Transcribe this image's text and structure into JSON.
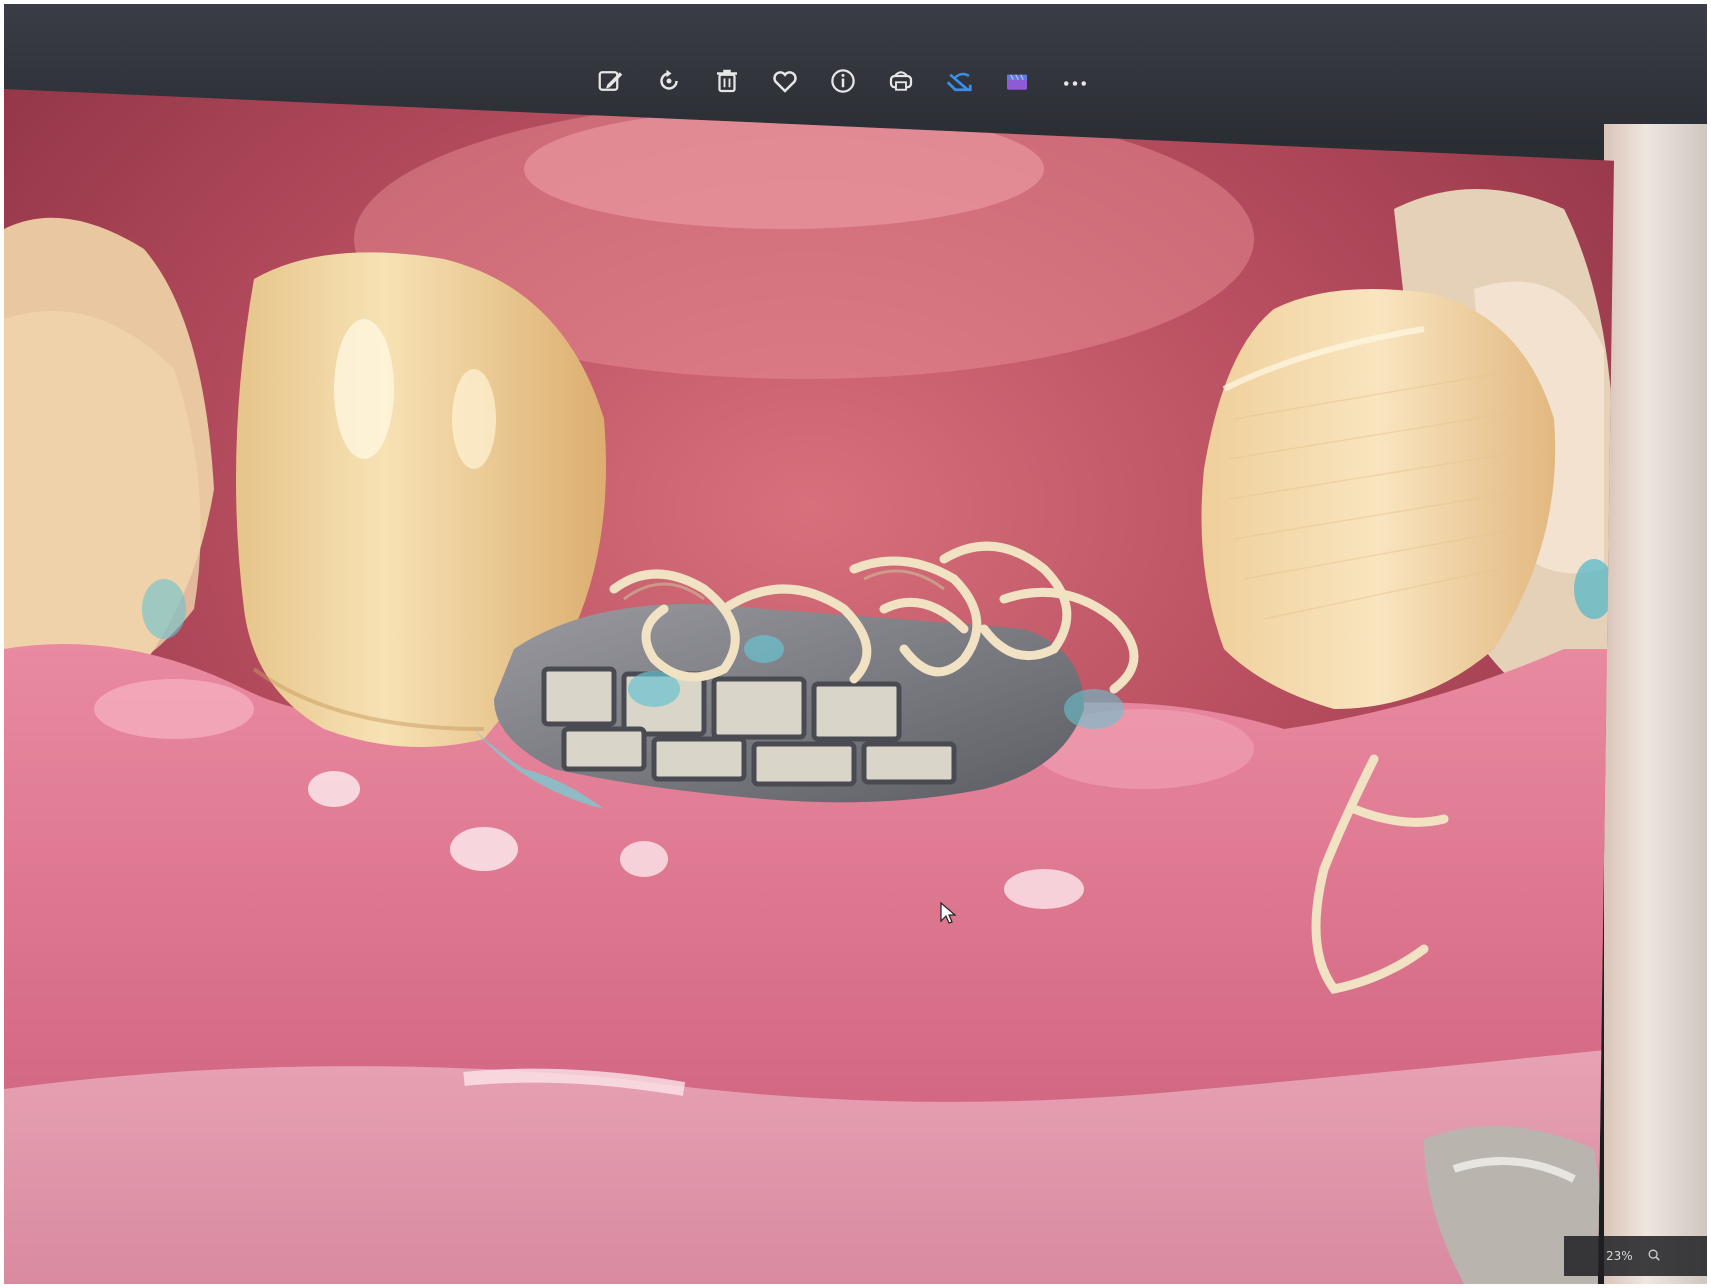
{
  "toolbar": {
    "icons": [
      "edit-icon",
      "rotate-icon",
      "delete-icon",
      "favorite-icon",
      "info-icon",
      "print-icon",
      "share-icon",
      "edit-video-icon",
      "more-icon"
    ]
  },
  "status": {
    "zoom": "23%"
  },
  "colors": {
    "toolbar_bg": "#33363c",
    "gum": "#e07f96",
    "tooth": "#f2d9a6",
    "accent_blue": "#3a8ee6",
    "accent_purple": "#8e5ad6"
  }
}
